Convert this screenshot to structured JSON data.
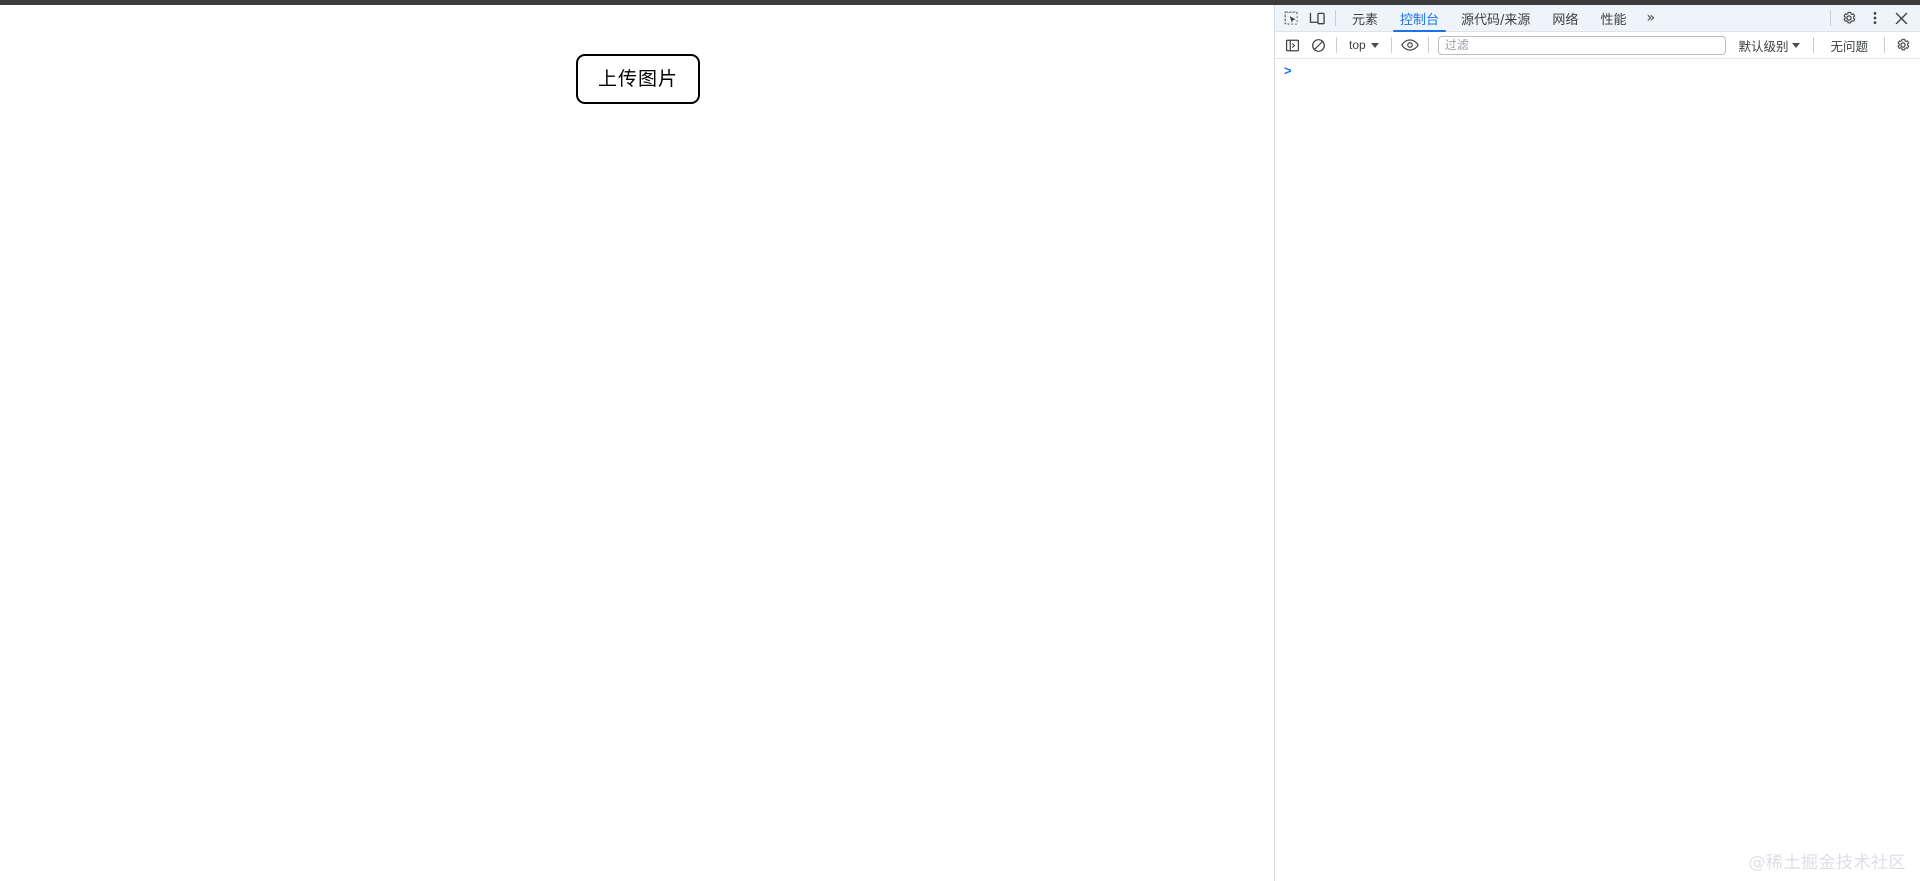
{
  "window": {
    "top_strip_color": "#3c3c3c",
    "page_background": "#ffffff"
  },
  "page": {
    "upload_button_label": "上传图片"
  },
  "devtools": {
    "panel_background": "#ffffff",
    "tabbar_background": "#eff3fa",
    "accent_color": "#1a73e8",
    "left_icons": [
      {
        "name": "inspect-element-icon",
        "title": "检查元素"
      },
      {
        "name": "device-toolbar-icon",
        "title": "切换设备工具栏"
      }
    ],
    "tabs": [
      {
        "label": "元素",
        "active": false
      },
      {
        "label": "控制台",
        "active": true
      },
      {
        "label": "源代码/来源",
        "active": false
      },
      {
        "label": "网络",
        "active": false
      },
      {
        "label": "性能",
        "active": false
      }
    ],
    "more_tabs_label": "»",
    "right_icons": [
      {
        "name": "settings-gear-icon",
        "title": "设置"
      },
      {
        "name": "more-options-icon",
        "title": "自定义及控制 DevTools"
      },
      {
        "name": "close-devtools-icon",
        "title": "关闭 DevTools"
      }
    ],
    "console_toolbar": {
      "sidebar_toggle_title": "显示控制台边栏",
      "clear_console_title": "清除控制台",
      "context_label": "top",
      "live_expression_title": "创建实时表达式",
      "filter_placeholder": "过滤",
      "filter_value": "",
      "level_label": "默认级别",
      "issues_label": "无问题",
      "settings_title": "控制台设置"
    },
    "console": {
      "prompt_symbol": ">",
      "prompt_value": "",
      "messages": []
    }
  },
  "watermark": {
    "text": "@稀土掘金技术社区"
  }
}
